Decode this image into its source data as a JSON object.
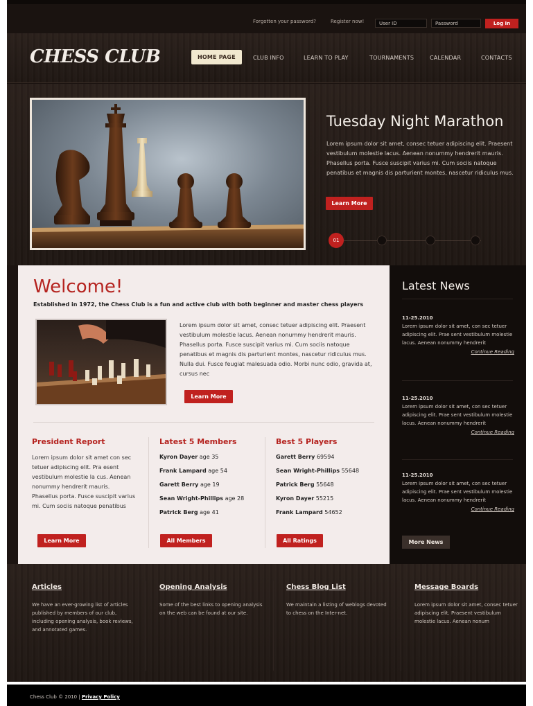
{
  "topbar": {
    "forgot": "Forgotten your password?",
    "register": "Register now!",
    "user_id": "User ID",
    "password": "Password",
    "login": "Log In"
  },
  "header": {
    "logo": "CHESS CLUB",
    "nav": [
      "HOME PAGE",
      "CLUB INFO",
      "LEARN TO PLAY",
      "TOURNAMENTS",
      "CALENDAR",
      "CONTACTS"
    ]
  },
  "hero": {
    "title": "Tuesday Night Marathon",
    "text": "Lorem ipsum dolor sit amet, consec tetuer adipiscing elit. Praesent vestibulum molestie lacus. Aenean nonummy hendrerit mauris. Phasellus porta. Fusce suscipit varius mi. Cum sociis natoque penatibus et magnis dis parturient montes, nascetur ridiculus mus.",
    "button": "Learn More",
    "pager_active": "01"
  },
  "welcome": {
    "title": "Welcome!",
    "subtitle": "Established in 1972, the Chess Club is a fun and active club with both beginner and master chess players",
    "text": "Lorem ipsum dolor sit amet, consec tetuer adipiscing elit. Praesent vestibulum molestie lacus. Aenean nonummy hendrerit mauris. Phasellus porta. Fusce suscipit varius mi. Cum sociis natoque penatibus et magnis dis parturient montes, nascetur ridiculus mus. Nulla dui. Fusce feugiat malesuada odio. Morbi nunc odio, gravida at, cursus nec",
    "button": "Learn More"
  },
  "president": {
    "title": "President Report",
    "text": "Lorem ipsum dolor sit amet con sec tetuer adipiscing elit. Pra esent vestibulum molestie la cus. Aenean nonummy hendrerit mauris. Phasellus porta. Fusce suscipit varius mi. Cum sociis natoque penatibus",
    "button": "Learn More"
  },
  "members": {
    "title": "Latest 5 Members",
    "items": [
      {
        "name": "Kyron Dayer",
        "age": "age 35"
      },
      {
        "name": "Frank Lampard",
        "age": "age 54"
      },
      {
        "name": "Garett Berry",
        "age": "age 19"
      },
      {
        "name": "Sean Wright-Phillips",
        "age": "age 28"
      },
      {
        "name": "Patrick Berg",
        "age": "age 41"
      }
    ],
    "button": "All Members"
  },
  "players": {
    "title": "Best 5 Players",
    "items": [
      {
        "name": "Garett Berry",
        "score": "69594"
      },
      {
        "name": "Sean Wright-Phillips",
        "score": "55648"
      },
      {
        "name": "Patrick Berg",
        "score": "55648"
      },
      {
        "name": "Kyron Dayer",
        "score": "55215"
      },
      {
        "name": "Frank Lampard",
        "score": "54652"
      }
    ],
    "button": "All Ratings"
  },
  "news": {
    "title": "Latest News",
    "items": [
      {
        "date": "11-25.2010",
        "text": "Lorem ipsum dolor sit amet, con sec tetuer adipiscing elit. Prae sent vestibulum molestie lacus. Aenean nonummy hendrerit",
        "more": "Continue Reading"
      },
      {
        "date": "11-25.2010",
        "text": "Lorem ipsum dolor sit amet, con sec tetuer adipiscing elit. Prae sent vestibulum molestie lacus. Aenean nonummy hendrerit",
        "more": "Continue Reading"
      },
      {
        "date": "11-25.2010",
        "text": "Lorem ipsum dolor sit amet, con sec tetuer adipiscing elit. Prae sent vestibulum molestie lacus. Aenean nonummy hendrerit",
        "more": "Continue Reading"
      }
    ],
    "button": "More News"
  },
  "footer": {
    "cols": [
      {
        "title": "Articles",
        "text": "We have an ever-growing list of articles published by members of our club, including opening analysis, book reviews, and annotated games."
      },
      {
        "title": "Opening Analysis",
        "text": "Some of the best links to opening analysis on the web can be found at our site."
      },
      {
        "title": "Chess Blog List",
        "text": "We maintain a listing of weblogs devoted to chess on the Inter-net."
      },
      {
        "title": "Message Boards",
        "text": "Lorem ipsum dolor sit amet, consec tetuer adipiscing elit. Praesent vestibulum molestie lacus. Aenean nonum"
      }
    ],
    "copyright": "Chess Club © 2010 |",
    "privacy": "Privacy Policy"
  },
  "colors": {
    "accent": "#c0211f",
    "title_red": "#b5231f",
    "dark": "#1c1411",
    "panel": "#f3eceb"
  }
}
